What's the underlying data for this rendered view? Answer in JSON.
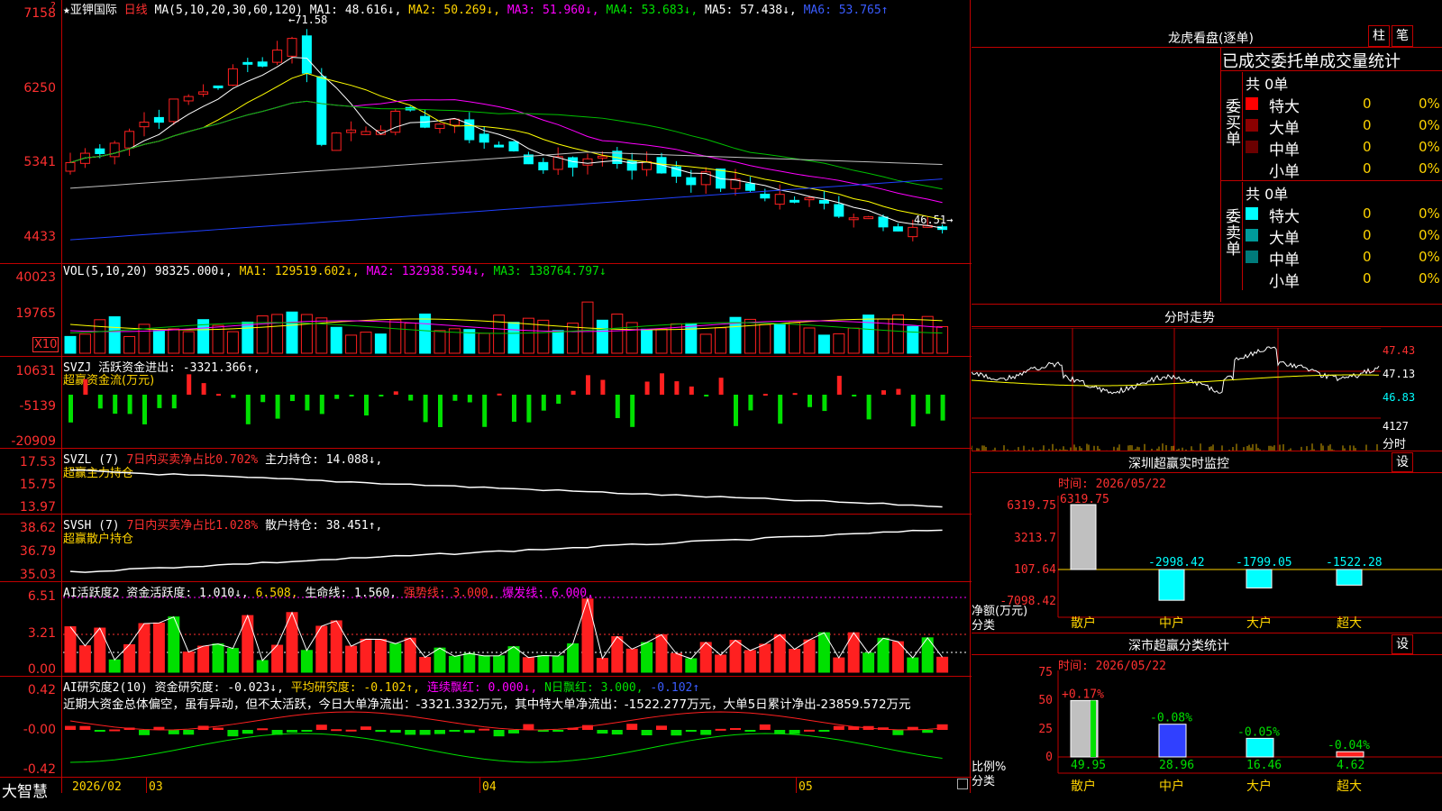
{
  "top_left_icon": "star-icon",
  "chart_header": {
    "name_label": "★亚钾国际",
    "period": "日线",
    "ma_spec": "MA(5,10,20,30,60,120)",
    "ma1": "MA1: 48.616↓,",
    "ma2": "MA2: 50.269↓,",
    "ma3": "MA3: 51.960↓,",
    "ma4": "MA4: 53.683↓,",
    "ma5": "MA5: 57.438↓,",
    "ma6": "MA6: 53.765↑"
  },
  "price_axis": [
    "7158",
    "6250",
    "5341",
    "4433"
  ],
  "price_marks": {
    "high_label": "71.58",
    "low_label": "46.51"
  },
  "volume_header": {
    "spec": "VOL(5,10,20)",
    "vol": "98325.000↓,",
    "ma1": "MA1: 129519.602↓,",
    "ma2": "MA2: 132938.594↓,",
    "ma3": "MA3: 138764.797↓"
  },
  "volume_axis": [
    "40023",
    "19765"
  ],
  "volume_unit": "X10",
  "svzj_header": {
    "spec": "SVZJ",
    "label": "活跃资金进出: -3321.366↑,",
    "sub": "超赢资金流(万元)"
  },
  "svzj_axis": [
    "10631",
    "-5139",
    "-20909"
  ],
  "svzl_header": {
    "spec": "SVZL (7)",
    "label": "7日内买卖净占比0.702%",
    "value": "主力持仓: 14.088↓,",
    "sub": "超赢主力持仓"
  },
  "svzl_axis": [
    "17.53",
    "15.75",
    "13.97"
  ],
  "svsh_header": {
    "spec": "SVSH (7)",
    "label": "7日内买卖净占比1.028%",
    "value": "散户持仓: 38.451↑,",
    "sub": "超赢散户持仓"
  },
  "svsh_axis": [
    "38.62",
    "36.79",
    "35.03"
  ],
  "ai1_header": {
    "spec": "AI活跃度2",
    "a": "资金活跃度: 1.010↓,",
    "b": "6.508,",
    "c": "生命线: 1.560,",
    "d": "强势线: 3.000,",
    "e": "爆发线: 6.000,"
  },
  "ai1_axis": [
    "6.51",
    "3.21",
    "0.00"
  ],
  "ai2_header": {
    "spec": "AI研究度2(10)",
    "a": "资金研究度: -0.023↓,",
    "b": "平均研究度: -0.102↑,",
    "c": "连续飘红: 0.000↓,",
    "d": "N日飘红: 3.000,",
    "e": "-0.102↑"
  },
  "ai2_comment": "近期大资金总体偏空，虽有异动，但不太活跃，今日大单净流出：-3321.332万元，其中特大单净流出：-1522.277万元，大单5日累计净出-23859.572万元",
  "ai2_axis": [
    "0.42",
    "-0.00",
    "-0.42"
  ],
  "bottom_bar": {
    "brand": "大智慧",
    "date": "2026/02",
    "m03": "03",
    "m04": "04",
    "m05": "05"
  },
  "right_panel": {
    "title": "龙虎看盘(逐单)",
    "btn_zhu": "柱",
    "btn_bi": "笔",
    "tabs": "已成交委托单成交量统计",
    "buy_group": {
      "side_label": "委买单",
      "total": "共 0单",
      "rows": [
        {
          "name": "特大",
          "count": "0",
          "pct": "0%",
          "color": "#ff0000"
        },
        {
          "name": "大单",
          "count": "0",
          "pct": "0%",
          "color": "#8b0000"
        },
        {
          "name": "中单",
          "count": "0",
          "pct": "0%",
          "color": "#6b0000"
        },
        {
          "name": "小单",
          "count": "0",
          "pct": "0%",
          "color": ""
        }
      ]
    },
    "sell_group": {
      "side_label": "委卖单",
      "total": "共 0单",
      "rows": [
        {
          "name": "特大",
          "count": "0",
          "pct": "0%",
          "color": "#00ffff"
        },
        {
          "name": "大单",
          "count": "0",
          "pct": "0%",
          "color": "#009a9a"
        },
        {
          "name": "中单",
          "count": "0",
          "pct": "0%",
          "color": "#007a7a"
        },
        {
          "name": "小单",
          "count": "0",
          "pct": "0%",
          "color": ""
        }
      ]
    },
    "intraday": {
      "title": "分时走势",
      "axis": [
        "47.43",
        "47.13",
        "46.83",
        "4127"
      ],
      "vol_label": "分时"
    },
    "monitor": {
      "title": "深圳超赢实时监控",
      "btn": "设",
      "time": "时间: 2026/05/22",
      "axis": [
        "6319.75",
        "3213.7",
        "107.64",
        "-7098.42"
      ],
      "ylabel": "净额(万元)",
      "xlabel": "分类",
      "categories": [
        "散户",
        "中户",
        "大户",
        "超大"
      ],
      "values": [
        "6319.75",
        "-2998.42",
        "-1799.05",
        "-1522.28"
      ]
    },
    "classify": {
      "title": "深市超赢分类统计",
      "btn": "设",
      "time": "时间: 2026/05/22",
      "axis": [
        "75",
        "50",
        "25",
        "0"
      ],
      "ylabel": "比例%",
      "xlabel": "分类",
      "categories": [
        "散户",
        "中户",
        "大户",
        "超大"
      ],
      "changes": [
        "+0.17%",
        "-0.08%",
        "-0.05%",
        "-0.04%"
      ],
      "values": [
        "49.95",
        "28.96",
        "16.46",
        "4.62"
      ]
    }
  },
  "colors": {
    "up": "#ff2020",
    "down": "#00ffff",
    "frame": "#c00000",
    "ma1": "#ffffff",
    "ma2": "#ffff00",
    "ma3": "#ff00ff",
    "ma4": "#00c000",
    "ma5": "#c0c0c0",
    "ma6": "#2040ff"
  }
}
